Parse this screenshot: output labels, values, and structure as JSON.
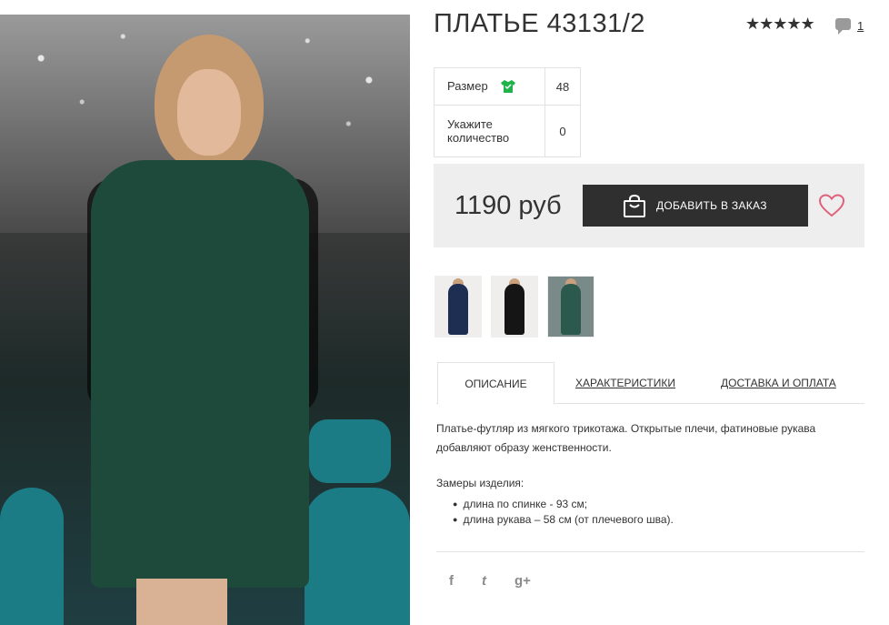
{
  "product": {
    "title": "ПЛАТЬЕ 43131/2",
    "rating": {
      "stars": "★★★★★",
      "value": 5,
      "max": 5
    },
    "comment_count": "1"
  },
  "options": {
    "size_label": "Размер",
    "size_value": "48",
    "qty_label_line1": "Укажите",
    "qty_label_line2": "количество",
    "qty_value": "0"
  },
  "buy": {
    "price": "1190 руб",
    "add_button": "ДОБАВИТЬ В ЗАКАЗ"
  },
  "thumbnails": [
    {
      "name": "thumbnail-navy-dress",
      "color": "#1e2d52"
    },
    {
      "name": "thumbnail-black-dress",
      "color": "#151515"
    },
    {
      "name": "thumbnail-green-dress",
      "color": "#2b5a4d"
    }
  ],
  "tabs": [
    {
      "label": "ОПИСАНИЕ",
      "active": true
    },
    {
      "label": "ХАРАКТЕРИСТИКИ",
      "active": false
    },
    {
      "label": "ДОСТАВКА И ОПЛАТА",
      "active": false
    }
  ],
  "description": {
    "text": "Платье-футляр из мягкого трикотажа. Открытые плечи, фатиновые рукава добавляют образу женственности.",
    "measures_title": "Замеры изделия:",
    "measures": [
      "длина по спинке - 93 см;",
      "длина рукава – 58 см (от плечевого шва)."
    ]
  },
  "social": [
    {
      "label": "f",
      "icon": "facebook-icon"
    },
    {
      "label": "t",
      "icon": "twitter-icon"
    },
    {
      "label": "g+",
      "icon": "google-plus-icon"
    }
  ],
  "colors": {
    "button_bg": "#2f2f2f",
    "buybox_bg": "#eeeeee",
    "heart": "#e0607c",
    "size_icon": "#1fb34a"
  }
}
